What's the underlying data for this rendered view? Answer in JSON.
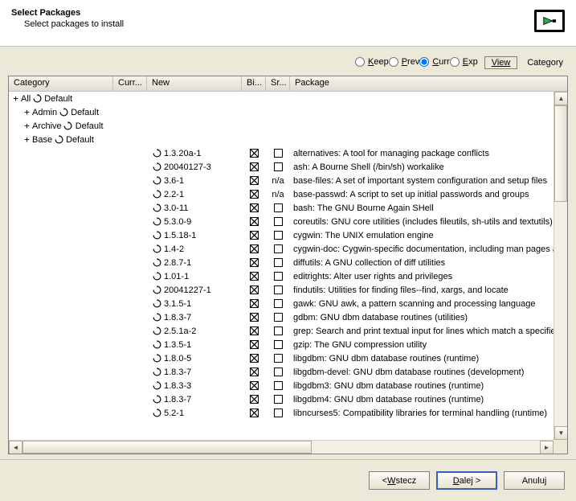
{
  "header": {
    "title": "Select Packages",
    "subtitle": "Select packages to install"
  },
  "toolbar": {
    "radios": [
      {
        "label": "Keep",
        "ul": "K",
        "rest": "eep",
        "checked": false
      },
      {
        "label": "Prev",
        "ul": "P",
        "rest": "rev",
        "checked": false
      },
      {
        "label": "Curr",
        "ul": "C",
        "rest": "urr",
        "checked": true
      },
      {
        "label": "Exp",
        "ul": "E",
        "rest": "xp",
        "checked": false
      }
    ],
    "view_label": "View",
    "view_mode": "Category"
  },
  "columns": {
    "category": "Category",
    "current": "Curr...",
    "new": "New",
    "bin": "Bi...",
    "src": "Sr...",
    "package": "Package"
  },
  "tree": [
    {
      "indent": 0,
      "exp": "+",
      "label": "All",
      "status": "Default"
    },
    {
      "indent": 1,
      "exp": "+",
      "label": "Admin",
      "status": "Default"
    },
    {
      "indent": 1,
      "exp": "+",
      "label": "Archive",
      "status": "Default"
    },
    {
      "indent": 1,
      "exp": "+",
      "label": "Base",
      "status": "Default"
    }
  ],
  "packages": [
    {
      "new": "1.3.20a-1",
      "bin": "x",
      "src": "box",
      "pkg": "alternatives: A tool for managing package conflicts"
    },
    {
      "new": "20040127-3",
      "bin": "x",
      "src": "box",
      "pkg": "ash: A Bourne Shell (/bin/sh) workalike"
    },
    {
      "new": "3.6-1",
      "bin": "x",
      "src": "na",
      "pkg": "base-files: A set of important system configuration and setup files"
    },
    {
      "new": "2.2-1",
      "bin": "x",
      "src": "na",
      "pkg": "base-passwd: A script to set up initial passwords and groups"
    },
    {
      "new": "3.0-11",
      "bin": "x",
      "src": "box",
      "pkg": "bash: The GNU Bourne Again SHell"
    },
    {
      "new": "5.3.0-9",
      "bin": "x",
      "src": "box",
      "pkg": "coreutils: GNU core utilities (includes fileutils, sh-utils and textutils)"
    },
    {
      "new": "1.5.18-1",
      "bin": "x",
      "src": "box",
      "pkg": "cygwin: The UNIX emulation engine"
    },
    {
      "new": "1.4-2",
      "bin": "x",
      "src": "box",
      "pkg": "cygwin-doc: Cygwin-specific documentation, including man pages an"
    },
    {
      "new": "2.8.7-1",
      "bin": "x",
      "src": "box",
      "pkg": "diffutils: A GNU collection of diff utilities"
    },
    {
      "new": "1.01-1",
      "bin": "x",
      "src": "box",
      "pkg": "editrights: Alter user rights and privileges"
    },
    {
      "new": "20041227-1",
      "bin": "x",
      "src": "box",
      "pkg": "findutils: Utilities for finding files--find, xargs, and locate"
    },
    {
      "new": "3.1.5-1",
      "bin": "x",
      "src": "box",
      "pkg": "gawk: GNU awk, a pattern scanning and processing language"
    },
    {
      "new": "1.8.3-7",
      "bin": "x",
      "src": "box",
      "pkg": "gdbm: GNU dbm database routines (utilities)"
    },
    {
      "new": "2.5.1a-2",
      "bin": "x",
      "src": "box",
      "pkg": "grep: Search and print textual input for lines which match a specified"
    },
    {
      "new": "1.3.5-1",
      "bin": "x",
      "src": "box",
      "pkg": "gzip: The GNU compression utility"
    },
    {
      "new": "1.8.0-5",
      "bin": "x",
      "src": "box",
      "pkg": "libgdbm: GNU dbm database routines (runtime)"
    },
    {
      "new": "1.8.3-7",
      "bin": "x",
      "src": "box",
      "pkg": "libgdbm-devel: GNU dbm database routines (development)"
    },
    {
      "new": "1.8.3-3",
      "bin": "x",
      "src": "box",
      "pkg": "libgdbm3: GNU dbm database routines (runtime)"
    },
    {
      "new": "1.8.3-7",
      "bin": "x",
      "src": "box",
      "pkg": "libgdbm4: GNU dbm database routines (runtime)"
    },
    {
      "new": "5.2-1",
      "bin": "x",
      "src": "box",
      "pkg": "libncurses5: Compatibility libraries for terminal handling (runtime)"
    }
  ],
  "na_text": "n/a",
  "footer": {
    "back_pre": "< ",
    "back_ul": "W",
    "back_rest": "stecz",
    "next_ul": "D",
    "next_rest": "alej >",
    "cancel": "Anuluj"
  }
}
